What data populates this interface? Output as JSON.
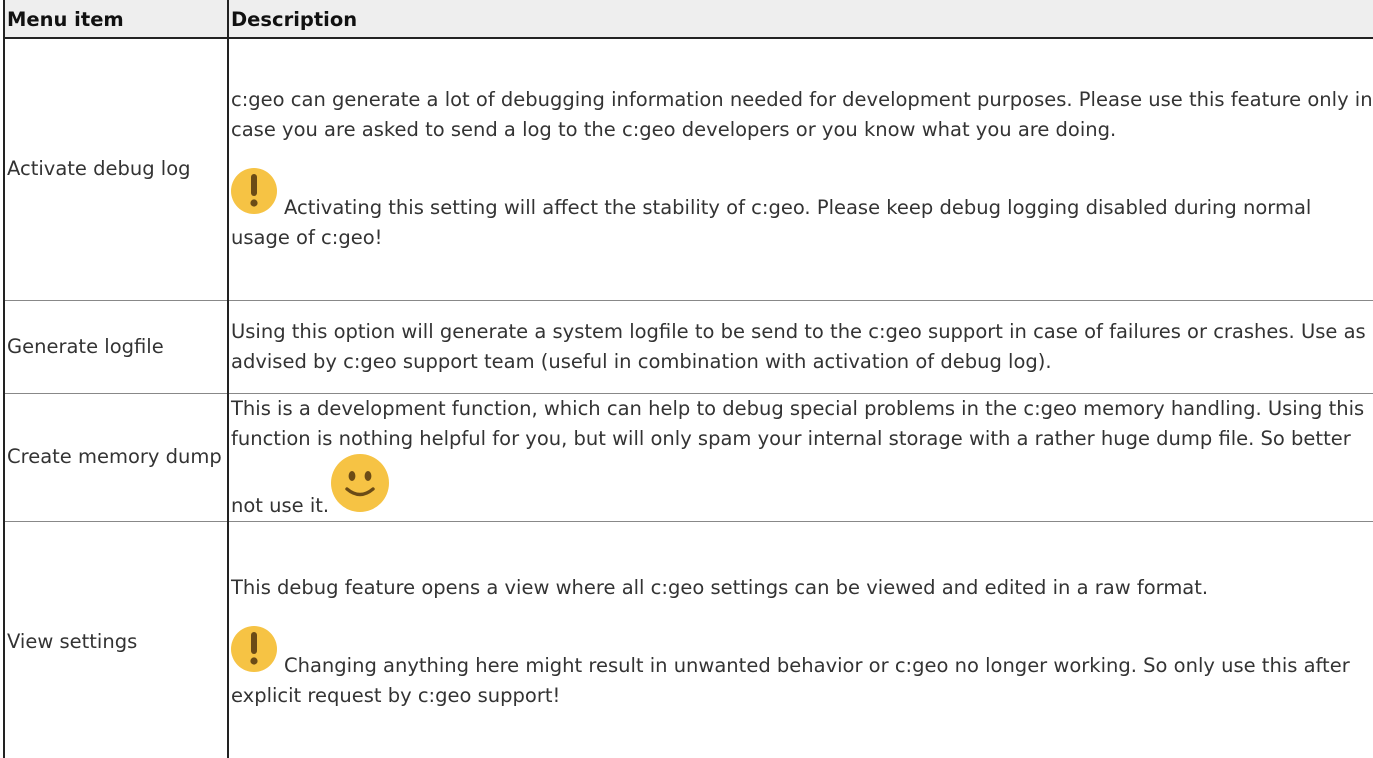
{
  "table": {
    "headers": {
      "menu_item": "Menu item",
      "description": "Description"
    },
    "rows": [
      {
        "item": "Activate debug log",
        "paragraph1": "c:geo can generate a lot of debugging information needed for development purposes. Please use this feature only in case you are asked to send a log to the c:geo developers or you know what you are doing.",
        "warning": "Activating this setting will affect the stability of c:geo. Please keep debug logging disabled during normal usage of c:geo!"
      },
      {
        "item": "Generate logfile",
        "paragraph1": "Using this option will generate a system logfile to be send to the c:geo support in case of failures or crashes. Use as advised by c:geo support team (useful in combination with activation of debug log)."
      },
      {
        "item": "Create memory dump",
        "paragraph1": "This is a development function, which can help to debug special problems in the c:geo memory handling. Using this function is nothing helpful for you, but will only spam your internal storage with a rather huge dump file. So better not use it."
      },
      {
        "item": "View settings",
        "paragraph1": "This debug feature opens a view where all c:geo settings can be viewed and edited in a raw format.",
        "warning": "Changing anything here might result in unwanted behavior or c:geo no longer working. So only use this after explicit request by c:geo support!"
      }
    ]
  },
  "icons": {
    "warning": "exclamation-icon",
    "smiley": "smiley-icon",
    "icon_color": "#f6c344"
  }
}
